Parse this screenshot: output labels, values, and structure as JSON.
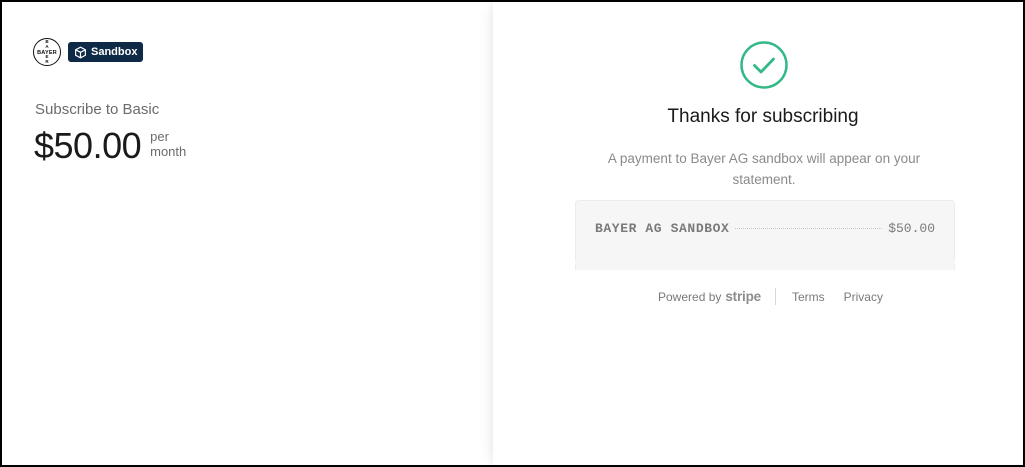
{
  "merchant": {
    "logo_text": "BAYER",
    "mode_badge": "Sandbox",
    "mode_icon": "sandbox-cube-icon"
  },
  "product": {
    "name": "Subscribe to Basic",
    "price": "$50.00",
    "interval_line1": "per",
    "interval_line2": "month"
  },
  "confirmation": {
    "icon": "checkmark-circle-icon",
    "title": "Thanks for subscribing",
    "note": "A payment to Bayer AG sandbox will appear on your statement."
  },
  "receipt": {
    "merchant": "BAYER AG SANDBOX",
    "amount": "$50.00"
  },
  "footer": {
    "powered_by": "Powered by",
    "brand": "stripe",
    "terms": "Terms",
    "privacy": "Privacy"
  },
  "colors": {
    "accent_green": "#33b887",
    "badge_navy": "#0e2a47"
  }
}
